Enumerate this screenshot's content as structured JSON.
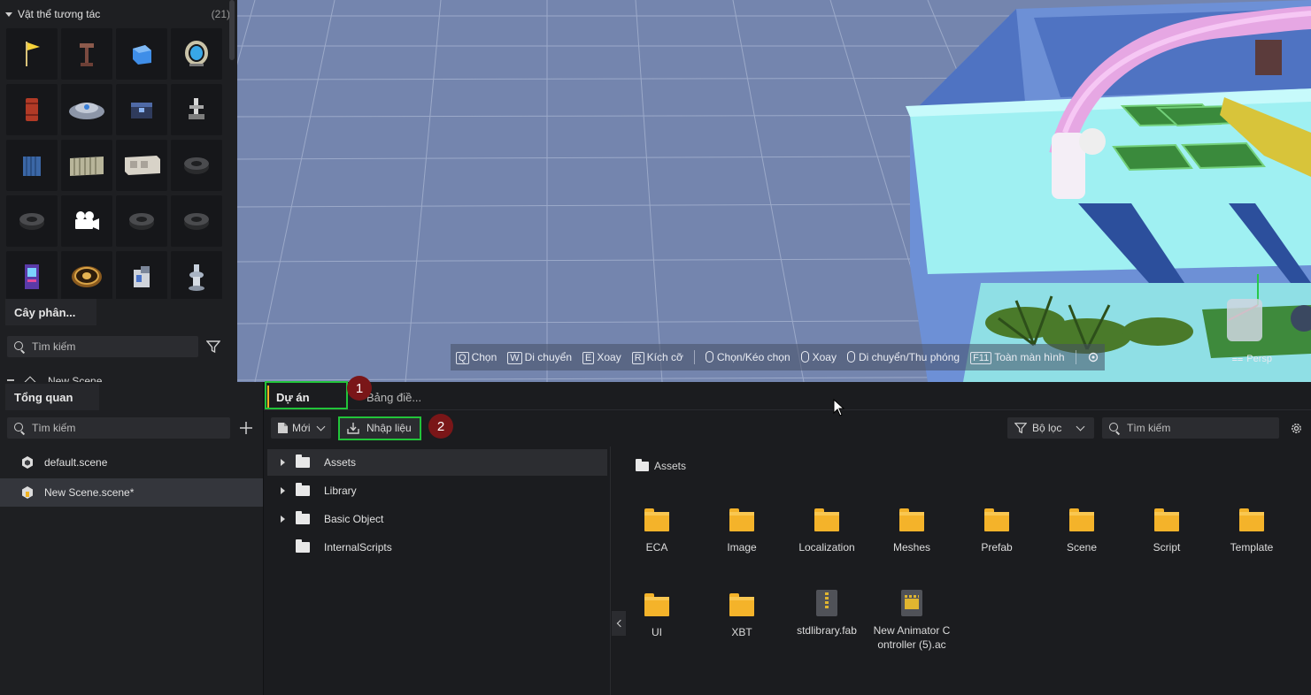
{
  "objects_panel": {
    "title": "Vật thể tương tác",
    "count": "(21)",
    "tiles": [
      "flag",
      "lamp-post",
      "blue-cube",
      "portal",
      "barrel",
      "ufo-pad",
      "chest",
      "robot-arm",
      "container",
      "fence",
      "trailer",
      "tire",
      "tire",
      "camera",
      "tire",
      "tire",
      "arcade",
      "coin",
      "machine",
      "fountain"
    ]
  },
  "hierarchy_panel": {
    "tab_label": "Cây phân...",
    "search_placeholder": "Tìm kiếm",
    "partial_item": "New Scene"
  },
  "viewport": {
    "toolbar": [
      {
        "key": "Q",
        "label": "Chọn"
      },
      {
        "key": "W",
        "label": "Di chuyển"
      },
      {
        "key": "E",
        "label": "Xoay"
      },
      {
        "key": "R",
        "label": "Kích cỡ"
      },
      {
        "mouse": true,
        "label": "Chọn/Kéo chọn"
      },
      {
        "mouse": true,
        "label": "Xoay"
      },
      {
        "mouse": true,
        "label": "Di chuyển/Thu phóng"
      },
      {
        "key": "F11",
        "label": "Toàn màn hình"
      }
    ],
    "persp": "Persp"
  },
  "overview": {
    "tab_label": "Tổng quan",
    "search_placeholder": "Tìm kiếm",
    "scenes": [
      {
        "label": "default.scene",
        "active": false
      },
      {
        "label": "New Scene.scene*",
        "active": true
      }
    ]
  },
  "project": {
    "tabs": [
      "Dự án",
      "Bảng điề..."
    ],
    "new_label": "Mới",
    "import_label": "Nhập liệu",
    "filter_label": "Bộ lọc",
    "search_placeholder": "Tìm kiếm",
    "tree": [
      {
        "label": "Assets",
        "expandable": true
      },
      {
        "label": "Library",
        "expandable": true
      },
      {
        "label": "Basic Object",
        "expandable": true
      },
      {
        "label": "InternalScripts",
        "expandable": false
      }
    ],
    "breadcrumb": "Assets",
    "assets": [
      {
        "label": "ECA",
        "kind": "folder"
      },
      {
        "label": "Image",
        "kind": "folder"
      },
      {
        "label": "Localization",
        "kind": "folder"
      },
      {
        "label": "Meshes",
        "kind": "folder"
      },
      {
        "label": "Prefab",
        "kind": "folder"
      },
      {
        "label": "Scene",
        "kind": "folder"
      },
      {
        "label": "Script",
        "kind": "folder"
      },
      {
        "label": "Template",
        "kind": "folder"
      },
      {
        "label": "UI",
        "kind": "folder"
      },
      {
        "label": "XBT",
        "kind": "folder"
      },
      {
        "label": "stdlibrary.fab",
        "kind": "archive"
      },
      {
        "label": "New Animator C ontroller (5).ac",
        "kind": "animator"
      }
    ]
  },
  "annotations": {
    "badge1": "1",
    "badge2": "2"
  },
  "colors": {
    "accent_green": "#22c43a",
    "badge": "#7a1618",
    "folder": "#f4b32a",
    "viewport_bg": "#7485ae"
  }
}
